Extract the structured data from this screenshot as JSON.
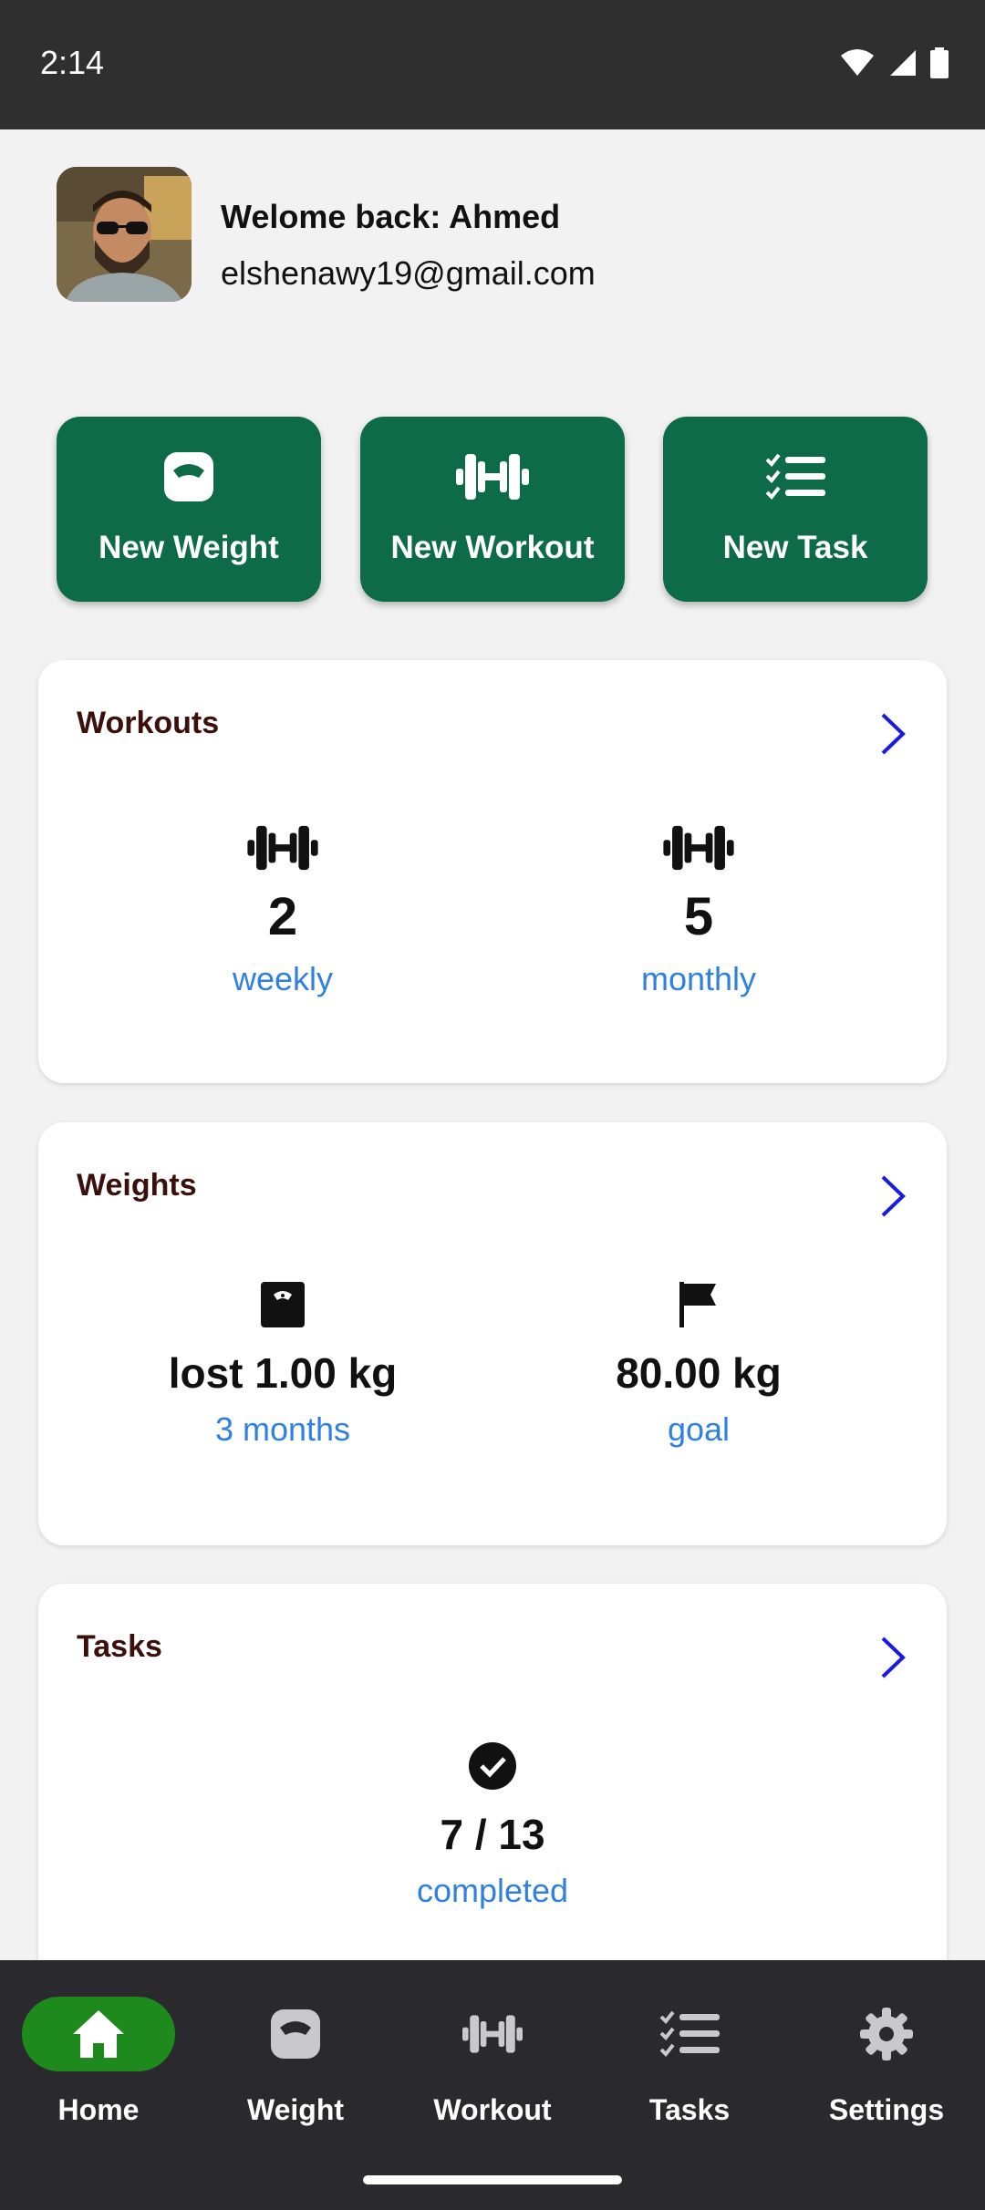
{
  "status_bar": {
    "time": "2:14"
  },
  "profile": {
    "greeting": "Welome back: Ahmed",
    "email": "elshenawy19@gmail.com"
  },
  "quick_actions": [
    {
      "label": "New Weight",
      "icon": "scale-icon"
    },
    {
      "label": "New Workout",
      "icon": "dumbbell-icon"
    },
    {
      "label": "New Task",
      "icon": "checklist-icon"
    }
  ],
  "workouts_card": {
    "title": "Workouts",
    "stats": [
      {
        "value": "2",
        "label": "weekly",
        "icon": "dumbbell-icon"
      },
      {
        "value": "5",
        "label": "monthly",
        "icon": "dumbbell-icon"
      }
    ]
  },
  "weights_card": {
    "title": "Weights",
    "stats": [
      {
        "value": "lost 1.00 kg",
        "label": "3 months",
        "icon": "scale-icon"
      },
      {
        "value": "80.00 kg",
        "label": "goal",
        "icon": "flag-icon"
      }
    ]
  },
  "tasks_card": {
    "title": "Tasks",
    "stats": [
      {
        "value": "7 / 13",
        "label": "completed",
        "icon": "check-circle-icon"
      }
    ]
  },
  "bottom_nav": {
    "items": [
      {
        "label": "Home",
        "icon": "home-icon",
        "selected": true
      },
      {
        "label": "Weight",
        "icon": "scale-icon"
      },
      {
        "label": "Workout",
        "icon": "dumbbell-icon"
      },
      {
        "label": "Tasks",
        "icon": "checklist-icon"
      },
      {
        "label": "Settings",
        "icon": "gear-icon"
      }
    ]
  },
  "colors": {
    "accent_green": "#0e6b47",
    "nav_selected": "#1e8a1e",
    "link_blue": "#2f80e0",
    "arrow_blue": "#1a1ae0",
    "card_title": "#3b0f0a"
  }
}
